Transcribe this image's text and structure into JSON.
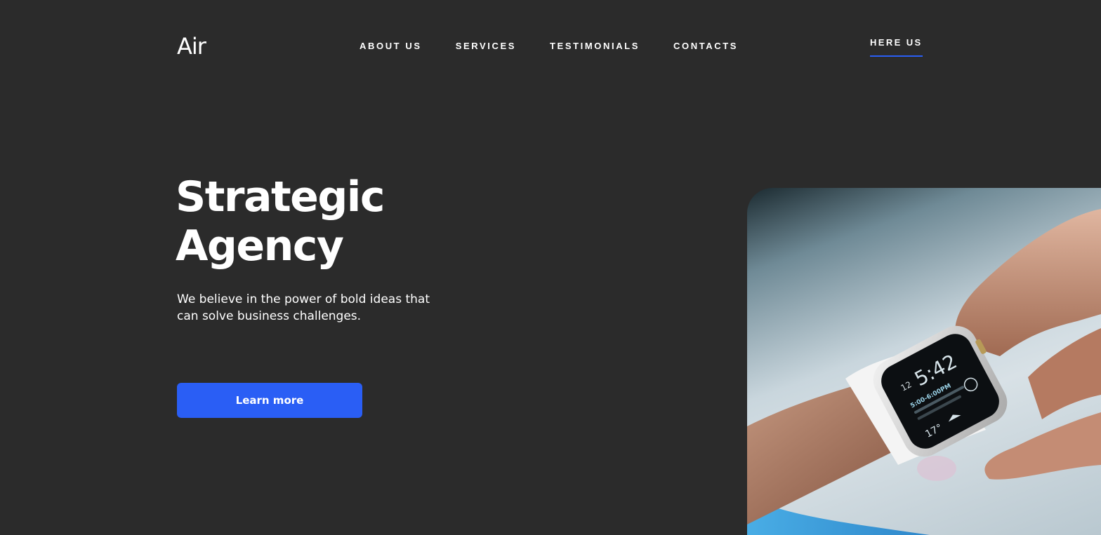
{
  "header": {
    "logo": "Air",
    "nav": [
      {
        "label": "ABOUT US"
      },
      {
        "label": "SERVICES"
      },
      {
        "label": "TESTIMONIALS"
      },
      {
        "label": "CONTACTS"
      }
    ],
    "cta_link": "HERE US"
  },
  "hero": {
    "title_line1": "Strategic",
    "title_line2": "Agency",
    "subtitle": "We believe in the power of bold ideas that can solve business challenges.",
    "button_label": "Learn more",
    "image_subject": "hand-with-smartwatch-photo",
    "watch": {
      "time": "5:42",
      "date": "12",
      "event_time": "5:00-6:00PM",
      "temperature": "17°"
    }
  },
  "colors": {
    "background": "#2b2b2b",
    "accent": "#2a5ef5",
    "text": "#ffffff"
  }
}
